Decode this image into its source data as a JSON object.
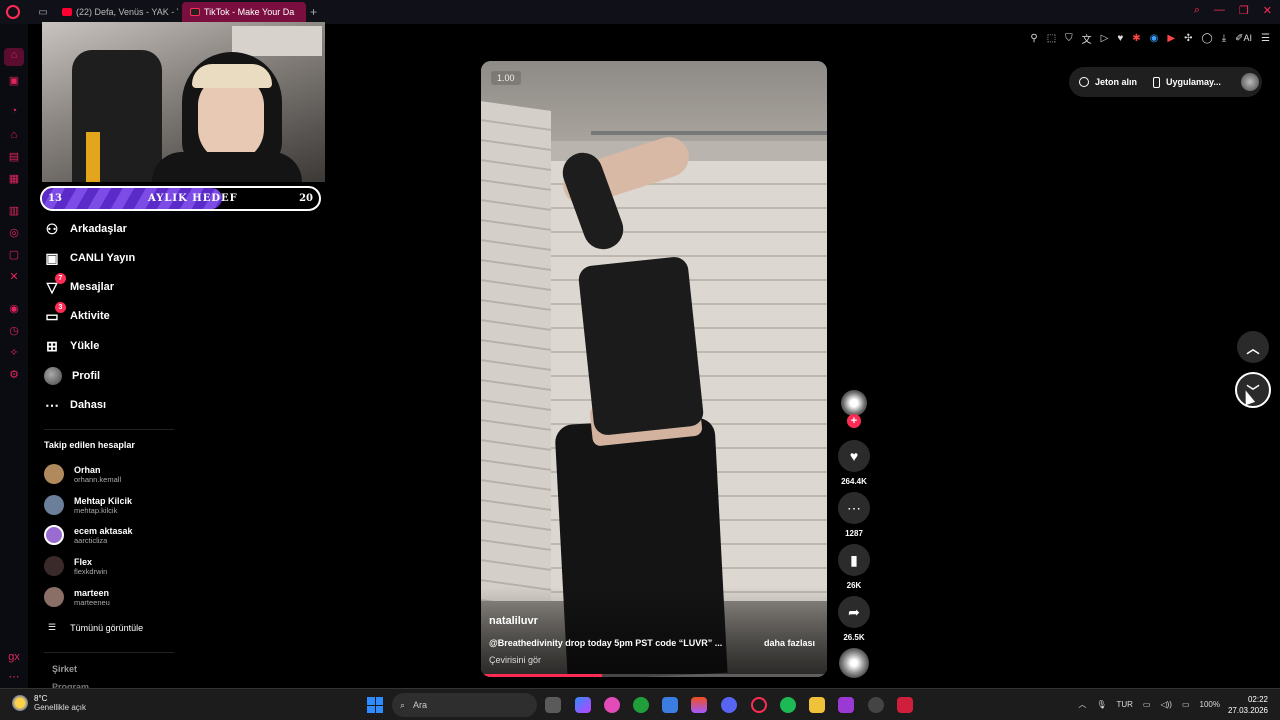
{
  "browser": {
    "tabs": [
      {
        "label": "(22) Defa, Venüs - YAK - Y",
        "active": false
      },
      {
        "label": "TikTok - Make Your Da",
        "active": true
      }
    ],
    "new_tab": "+",
    "ai_label": "AI"
  },
  "stream_overlay": {
    "goal_start": "13",
    "goal_label": "AYLIK HEDEF",
    "goal_end": "20",
    "goal_progress": 0.65
  },
  "tiktok": {
    "nav": [
      {
        "label": "Arkadaşlar",
        "icon": "friends-icon"
      },
      {
        "label": "CANLI Yayın",
        "icon": "live-icon"
      },
      {
        "label": "Mesajlar",
        "icon": "messages-icon",
        "badge": "7"
      },
      {
        "label": "Aktivite",
        "icon": "activity-icon",
        "badge": "3"
      },
      {
        "label": "Yükle",
        "icon": "upload-icon"
      },
      {
        "label": "Profil",
        "icon": "profile-avatar"
      },
      {
        "label": "Dahası",
        "icon": "more-icon"
      }
    ],
    "following_title": "Takip edilen hesaplar",
    "following": [
      {
        "name": "Orhan",
        "handle": "orhann.kemall",
        "color": "#b08a5c"
      },
      {
        "name": "Mehtap Kilcik",
        "handle": "mehtap.kilcik",
        "color": "#6b7f9a"
      },
      {
        "name": "ecem aktasak",
        "handle": "aarcticliza",
        "color": "#9a6bd1"
      },
      {
        "name": "Flex",
        "handle": "flexkdrwin",
        "color": "#3a2a2a"
      },
      {
        "name": "marteen",
        "handle": "marteeneu",
        "color": "#8a6f66"
      }
    ],
    "see_all": "Tümünü görüntüle",
    "company": "Şirket",
    "program": "Program"
  },
  "video": {
    "speed": "1.00",
    "author": "nataliluvr",
    "caption": "@Breathedivinity drop today 5pm PST code “LUVR” ...",
    "more": "daha fazlası",
    "translate": "Çevirisini gör",
    "progress": 0.35
  },
  "actions": {
    "follow_plus": "+",
    "likes": "264.4K",
    "comments": "1287",
    "saves": "26K",
    "shares": "26.5K"
  },
  "header_right": {
    "coins": "Jeton alın",
    "app": "Uygulamay..."
  },
  "taskbar": {
    "temp": "8°C",
    "weather": "Genellikle açık",
    "search": "Ara",
    "lang": "TUR",
    "battery": "100%",
    "time": "02:22",
    "date": "27.03.2026"
  },
  "colors": {
    "accent": "#fe2c55",
    "opera": "#ff2d55",
    "goal_fill": "#5b2bc9"
  }
}
